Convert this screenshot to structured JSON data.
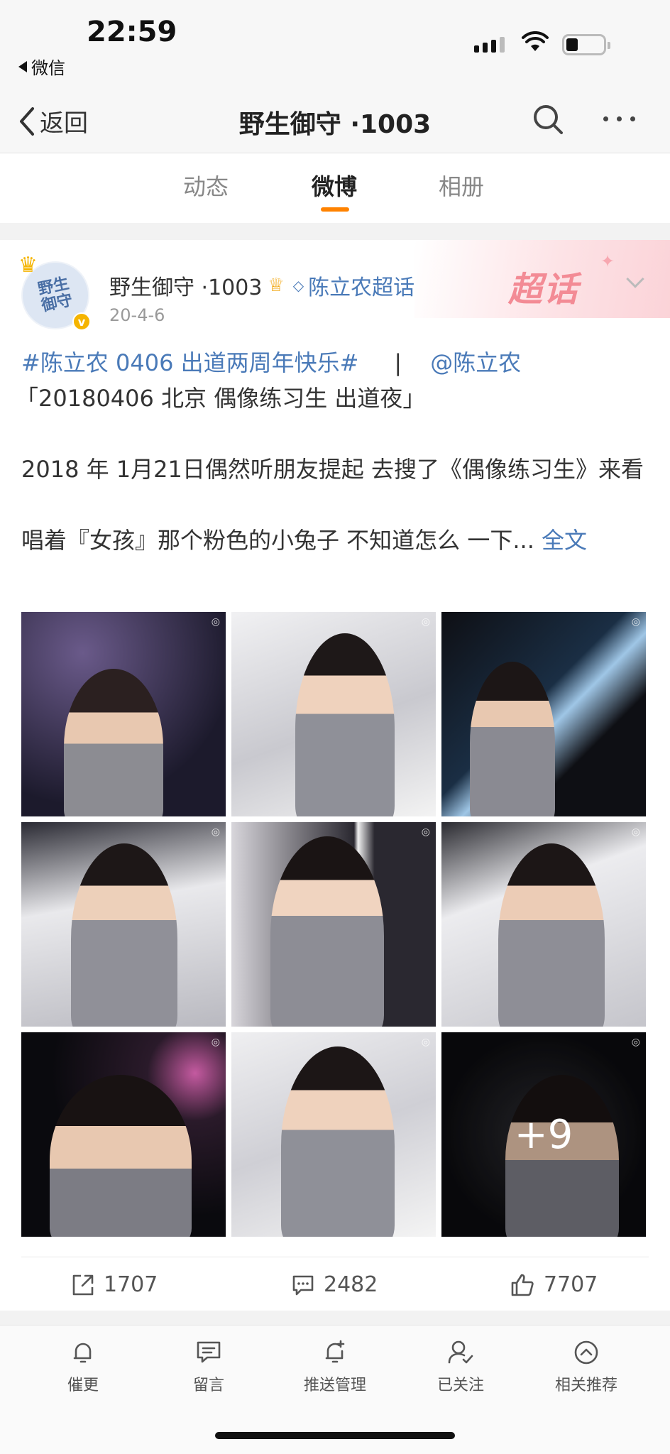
{
  "status_bar": {
    "time": "22:59",
    "back_app": "微信"
  },
  "nav": {
    "back_label": "返回",
    "title": "野生御守 ·1003"
  },
  "tabs": [
    {
      "label": "动态",
      "active": false
    },
    {
      "label": "微博",
      "active": true
    },
    {
      "label": "相册",
      "active": false
    }
  ],
  "post": {
    "avatar_text": "野生御守",
    "username": "野生御守 ·1003",
    "topic": "陈立农超话",
    "date": "20-4-6",
    "supertopic_badge": "超话",
    "hashtag": "#陈立农 0406 出道两周年快乐#",
    "separator": "|",
    "mention": "@陈立农",
    "line1": "「20180406 北京 偶像练习生 出道夜」",
    "line2": "2018 年 1月21日偶然听朋友提起 去搜了《偶像练习生》来看",
    "line3": "唱着『女孩』那个粉色的小兔子 不知道怎么 一下...",
    "full_text": "全文",
    "more_photos": "+9",
    "stats": {
      "reposts": "1707",
      "comments": "2482",
      "likes": "7707"
    }
  },
  "bottom_bar": [
    {
      "label": "催更",
      "icon": "bell-icon"
    },
    {
      "label": "留言",
      "icon": "message-icon"
    },
    {
      "label": "推送管理",
      "icon": "push-bell-icon"
    },
    {
      "label": "已关注",
      "icon": "followed-user-icon"
    },
    {
      "label": "相关推荐",
      "icon": "recommend-icon"
    }
  ],
  "colors": {
    "accent": "#ff8200",
    "link": "#4a7ab8",
    "badge": "#f38b95"
  }
}
